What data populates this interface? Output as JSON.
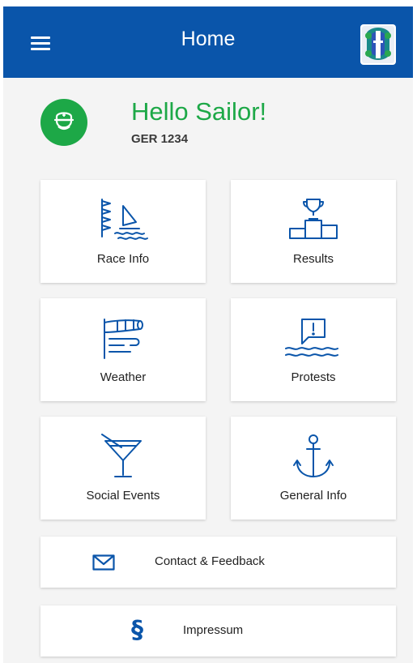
{
  "header": {
    "title": "Home",
    "menu_icon": "hamburger-menu-icon",
    "logo_icon": "regatta-logo-icon",
    "background_color": "#0a55aa"
  },
  "user": {
    "greeting": "Hello Sailor!",
    "sail_number": "GER 1234",
    "avatar_icon": "sailor-cap-icon",
    "accent_color": "#1da847"
  },
  "tiles": [
    {
      "label": "Race Info",
      "icon": "race-flags-sail-icon"
    },
    {
      "label": "Results",
      "icon": "trophy-podium-icon"
    },
    {
      "label": "Weather",
      "icon": "windsock-icon"
    },
    {
      "label": "Protests",
      "icon": "protest-message-waves-icon"
    },
    {
      "label": "Social Events",
      "icon": "cocktail-glass-icon"
    },
    {
      "label": "General Info",
      "icon": "anchor-icon"
    }
  ],
  "actions": [
    {
      "label": "Contact & Feedback",
      "icon": "envelope-icon"
    },
    {
      "label": "Impressum",
      "icon": "section-sign-icon",
      "glyph": "§"
    }
  ],
  "icon_color": "#0a55aa"
}
